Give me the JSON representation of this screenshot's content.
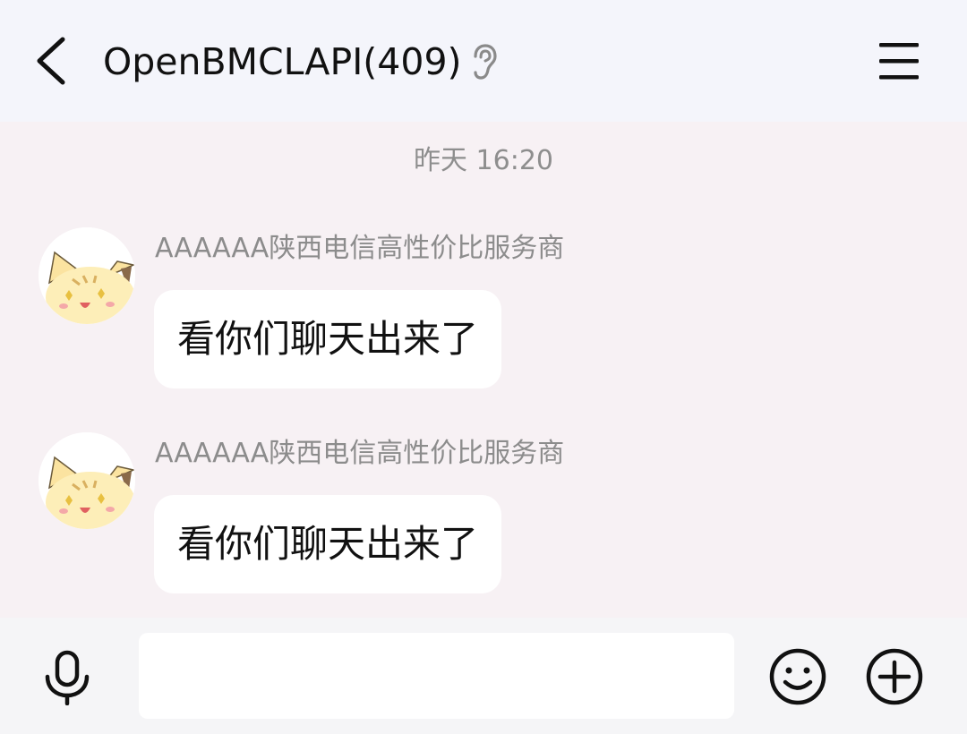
{
  "header": {
    "title": "OpenBMCLAPI(409)",
    "back_icon": "chevron-left-icon",
    "ear_icon": "ear-icon",
    "menu_icon": "hamburger-menu-icon"
  },
  "chat": {
    "timestamp": "昨天 16:20",
    "messages": [
      {
        "sender": "AAAAAA陕西电信高性价比服务商",
        "text": "看你们聊天出来了",
        "avatar": "cat-avatar"
      },
      {
        "sender": "AAAAAA陕西电信高性价比服务商",
        "text": "看你们聊天出来了",
        "avatar": "cat-avatar"
      }
    ]
  },
  "input_bar": {
    "placeholder": "",
    "value": "",
    "mic_icon": "microphone-icon",
    "emoji_icon": "smiley-icon",
    "plus_icon": "plus-circle-icon"
  }
}
